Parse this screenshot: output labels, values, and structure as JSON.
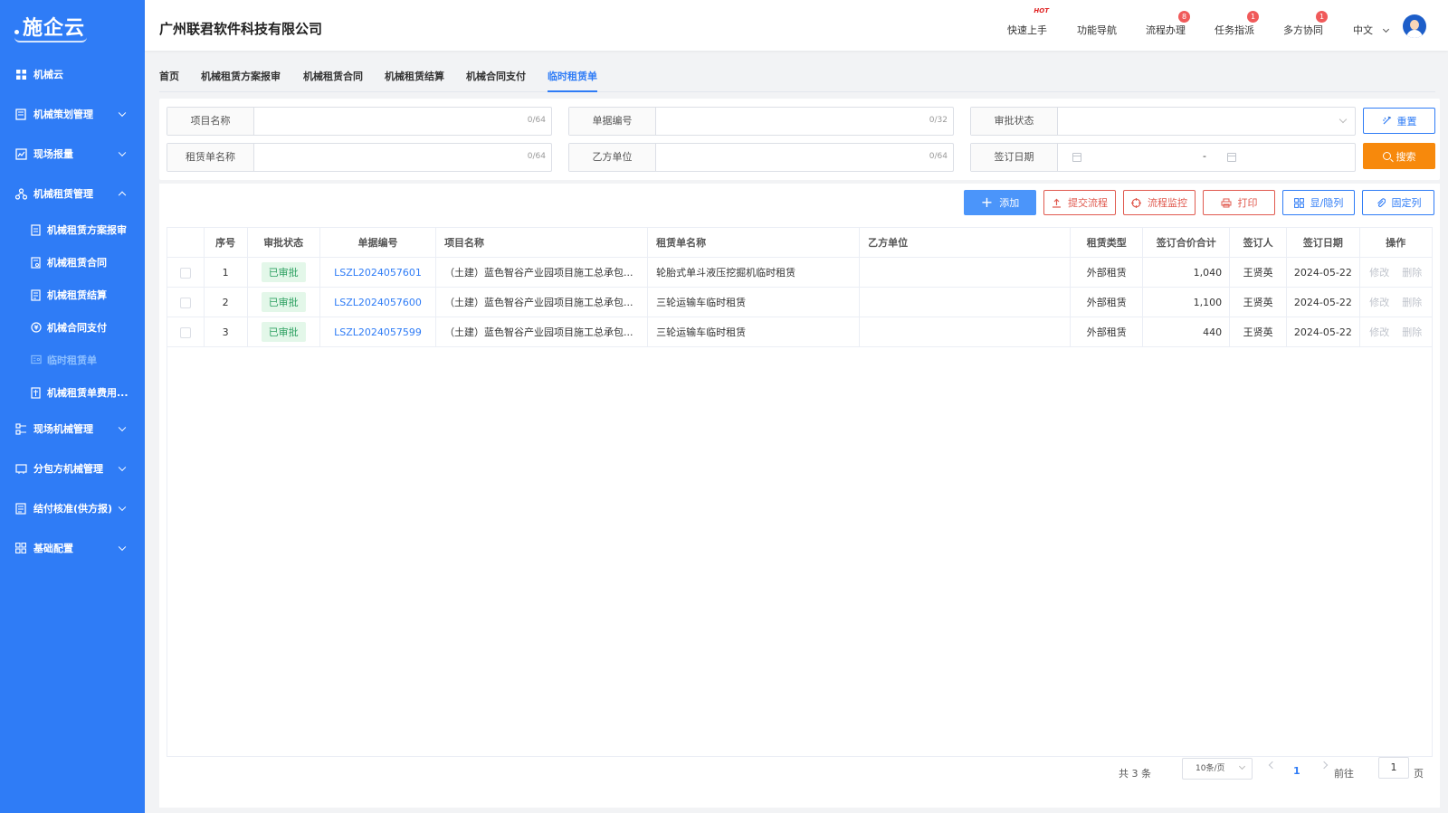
{
  "brand": {
    "logo_text": "施企云"
  },
  "sidebar": {
    "items": [
      {
        "label": "机械云",
        "icon": "grid-icon"
      },
      {
        "label": "机械策划管理",
        "icon": "plan-icon"
      },
      {
        "label": "现场报量",
        "icon": "report-icon"
      },
      {
        "label": "机械租赁管理",
        "icon": "org-icon",
        "expanded": true
      },
      {
        "label": "现场机械管理",
        "icon": "machine-icon"
      },
      {
        "label": "分包方机械管理",
        "icon": "subcontract-icon"
      },
      {
        "label": "结付核准(供方报)",
        "icon": "settle-icon"
      },
      {
        "label": "基础配置",
        "icon": "config-icon"
      }
    ],
    "sub_items": [
      {
        "label": "机械租赁方案报审"
      },
      {
        "label": "机械租赁合同"
      },
      {
        "label": "机械租赁结算"
      },
      {
        "label": "机械合同支付"
      },
      {
        "label": "临时租赁单",
        "active": true
      },
      {
        "label": "机械租赁单费用..."
      }
    ]
  },
  "header": {
    "company": "广州联君软件科技有限公司",
    "nav": [
      {
        "label": "快速上手",
        "tag": "HOT"
      },
      {
        "label": "功能导航"
      },
      {
        "label": "流程办理",
        "badge": "8"
      },
      {
        "label": "任务指派",
        "badge": "1"
      },
      {
        "label": "多方协同",
        "badge": "1"
      }
    ],
    "language": "中文"
  },
  "tabs": [
    "首页",
    "机械租赁方案报审",
    "机械租赁合同",
    "机械租赁结算",
    "机械合同支付",
    "临时租赁单"
  ],
  "filters": {
    "project_name": {
      "label": "项目名称",
      "count": "0/64"
    },
    "doc_no": {
      "label": "单据编号",
      "count": "0/32"
    },
    "approval_status": {
      "label": "审批状态"
    },
    "lease_name": {
      "label": "租赁单名称",
      "count": "0/64"
    },
    "party_b": {
      "label": "乙方单位",
      "count": "0/64"
    },
    "sign_date": {
      "label": "签订日期",
      "separator": "-"
    },
    "reset_label": "重置",
    "search_label": "搜索"
  },
  "toolbar": {
    "add": "添加",
    "submit": "提交流程",
    "monitor": "流程监控",
    "print": "打印",
    "columns": "显/隐列",
    "pin": "固定列"
  },
  "table": {
    "headers": [
      "序号",
      "审批状态",
      "单据编号",
      "项目名称",
      "租赁单名称",
      "乙方单位",
      "租赁类型",
      "签订合价合计",
      "签订人",
      "签订日期",
      "操作"
    ],
    "rows": [
      {
        "no": "1",
        "status": "已审批",
        "doc": "LSZL2024057601",
        "project": "（土建）蓝色智谷产业园项目施工总承包...",
        "lease": "轮胎式单斗液压挖掘机临时租赁",
        "partyb": "",
        "type": "外部租赁",
        "amount": "1,040",
        "signer": "王贤英",
        "date": "2024-05-22",
        "edit": "修改",
        "del": "删除"
      },
      {
        "no": "2",
        "status": "已审批",
        "doc": "LSZL2024057600",
        "project": "（土建）蓝色智谷产业园项目施工总承包...",
        "lease": "三轮运输车临时租赁",
        "partyb": "",
        "type": "外部租赁",
        "amount": "1,100",
        "signer": "王贤英",
        "date": "2024-05-22",
        "edit": "修改",
        "del": "删除"
      },
      {
        "no": "3",
        "status": "已审批",
        "doc": "LSZL2024057599",
        "project": "（土建）蓝色智谷产业园项目施工总承包...",
        "lease": "三轮运输车临时租赁",
        "partyb": "",
        "type": "外部租赁",
        "amount": "440",
        "signer": "王贤英",
        "date": "2024-05-22",
        "edit": "修改",
        "del": "删除"
      }
    ]
  },
  "pagination": {
    "total": "共 3 条",
    "page_size": "10条/页",
    "current": "1",
    "goto_label": "前往",
    "goto_value": "1",
    "page_suffix": "页"
  },
  "colors": {
    "primary": "#2f7cf6",
    "accent": "#f7890c",
    "danger": "#e05a4f",
    "success": "#2ea162"
  }
}
